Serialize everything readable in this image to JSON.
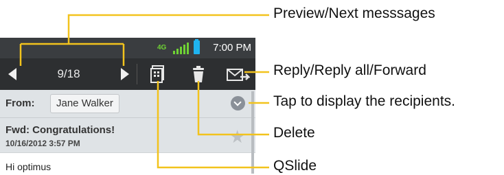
{
  "status_bar": {
    "network": "4G",
    "time": "7:00 PM"
  },
  "toolbar": {
    "counter": "9/18",
    "icons": [
      "prev-arrow-icon",
      "next-arrow-icon",
      "qslide-icon",
      "trash-icon",
      "reply-icon"
    ]
  },
  "email": {
    "from_label": "From:",
    "sender": "Jane Walker",
    "subject": "Fwd: Congratulations!",
    "date": "10/16/2012 3:57 PM",
    "body": "Hi optimus"
  },
  "callouts": {
    "preview_next": "Preview/Next messsages",
    "reply": "Reply/Reply all/Forward",
    "recipients": "Tap to display the recipients.",
    "delete": "Delete",
    "qslide": "QSlide"
  },
  "colors": {
    "callout_line": "#f2c31d",
    "status_bar": "#3a3d40",
    "toolbar": "#2d2f31",
    "header_bg": "#dfe3e6",
    "battery": "#1fb3f0"
  }
}
